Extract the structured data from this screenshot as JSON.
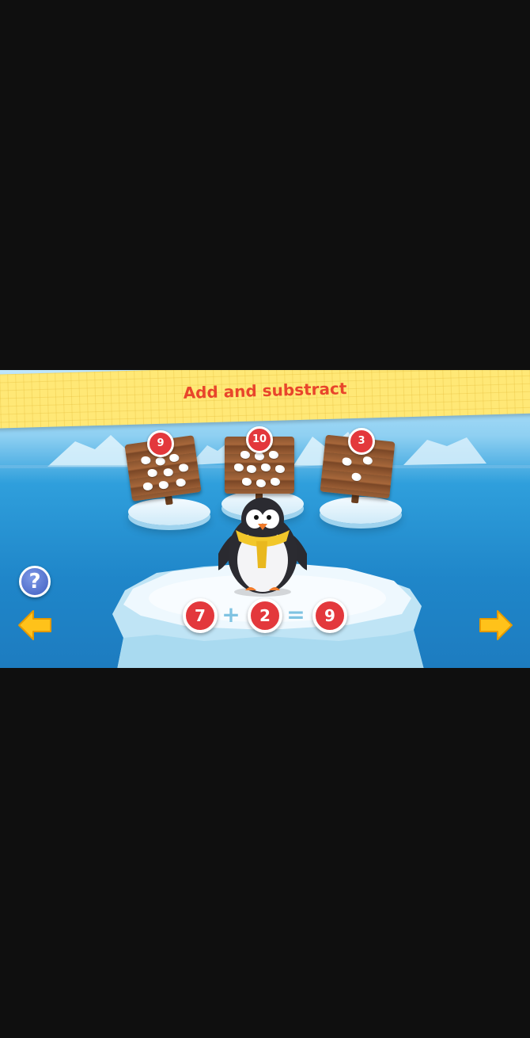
{
  "title": "Add and substract",
  "signs": [
    {
      "badge": "9",
      "snowballs": 9
    },
    {
      "badge": "10",
      "snowballs": 10
    },
    {
      "badge": "3",
      "snowballs": 3
    }
  ],
  "equation": {
    "operand1": "7",
    "operator": "+",
    "operand2": "2",
    "equals": "=",
    "result": "9"
  },
  "help": {
    "label": "?"
  },
  "colors": {
    "banner": "#ffe876",
    "title": "#e8452b",
    "badge": "#e3383c",
    "arrow": "#ffc21a",
    "help": "#4a6bd0"
  },
  "icons": {
    "help": "question-icon",
    "prev": "arrow-left-icon",
    "next": "arrow-right-icon",
    "character": "penguin"
  }
}
